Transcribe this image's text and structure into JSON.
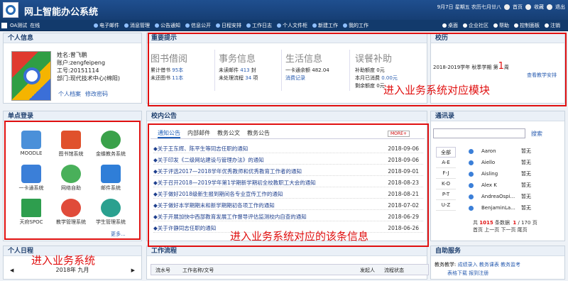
{
  "header": {
    "title": "网上智能办公系统",
    "top_right": [
      "9月7日 星期五 农历七月廿八",
      "首页",
      "收藏",
      "退出"
    ]
  },
  "user_bar": {
    "name": "OA测试",
    "status": "在线"
  },
  "nav": {
    "items": [
      "电子邮件",
      "消息管理",
      "公告通知",
      "信息公开",
      "日程安排",
      "工作日志",
      "个人文件柜",
      "新建工作",
      "我的工作"
    ],
    "right_items": [
      "桌面",
      "企业社区",
      "帮助",
      "控制面板",
      "注销"
    ]
  },
  "personal_info": {
    "title": "个人信息",
    "name": "姓名:曾飞鹏",
    "account": "账户:zengfeipeng",
    "job_no": "工号:20151114",
    "dept": "部门:现代技术中心(绵阳)",
    "link_profile": "个人档案",
    "link_password": "修改密码"
  },
  "notices": {
    "title": "重要提示",
    "library": {
      "title": "图书借阅",
      "r1_label": "累计借书",
      "r1_value": "95本",
      "r2_label": "未还图书",
      "r2_value": "11本"
    },
    "affairs": {
      "title": "事务信息",
      "r1_label": "未读邮件",
      "r1_value": "413",
      "r1_unit": "封",
      "r2_label": "未处理流程",
      "r2_value": "34",
      "r2_unit": "项"
    },
    "life": {
      "title": "生活信息",
      "r1_label": "一卡通余额",
      "r1_value": "482.04",
      "link": "消费记录"
    },
    "subsidy": {
      "title": "误餐补助",
      "r1_label": "补助额度",
      "r1_value": "0元",
      "r2_label": "本月已消费",
      "r2_value": "0.00元",
      "r3_label": "剩余额度",
      "r3_value": "0元"
    }
  },
  "calendar": {
    "title": "校历",
    "term": "2018-2019学年 秋季学期 第",
    "week": "1",
    "week_unit": "周",
    "link": "查看教学安排"
  },
  "sso": {
    "title": "单点登录",
    "apps": [
      "MOODLE",
      "图书馆系统",
      "金蝶教务系统",
      "一卡通系统",
      "网络自助",
      "邮件系统",
      "天府SPOC",
      "教学管理系统",
      "学生管理系统"
    ],
    "more": "更多..."
  },
  "news": {
    "title": "校内公告",
    "tabs": [
      "通知公告",
      "内部邮件",
      "教务公文",
      "教务公告"
    ],
    "more_btn": "MORE+",
    "items": [
      {
        "title": "◆关于王东辉、陈平生等同志任职的通知",
        "date": "2018-09-06"
      },
      {
        "title": "◆关于印发《二级网站建设与管理办法》的通知",
        "date": "2018-09-06"
      },
      {
        "title": "◆关于评选2017—2018学年优秀教师和优秀教育工作者的通知",
        "date": "2018-09-01"
      },
      {
        "title": "◆关于召开2018—2019学年第1学期新学期初全校教职工大会的通知",
        "date": "2018-08-23"
      },
      {
        "title": "◆关于做好2018级新生报到期间各专业宣传工作的通知",
        "date": "2018-08-21"
      },
      {
        "title": "◆关于做好本学期期末和新学期期初各项工作的通知",
        "date": "2018-07-02"
      },
      {
        "title": "◆关于开展加快中西部教育发展工作督导评估监测校内自查的通知",
        "date": "2018-06-29"
      },
      {
        "title": "◆关于许静同志任职的通知",
        "date": "2018-06-26"
      }
    ]
  },
  "workflow": {
    "title": "工作流程",
    "cols": [
      "流水号",
      "工作名称/文号",
      "发起人",
      "流程状态"
    ]
  },
  "schedule": {
    "title": "个人日程",
    "month": "2018年 九月"
  },
  "address_book": {
    "title": "通讯录",
    "search_btn": "搜索",
    "letters": [
      "全部",
      "A-E",
      "F-J",
      "K-O",
      "P-T",
      "U-Z"
    ],
    "contacts": [
      {
        "name": "Aaron",
        "status": "暂无"
      },
      {
        "name": "Aiello",
        "status": "暂无"
      },
      {
        "name": "Aisling",
        "status": "暂无"
      },
      {
        "name": "Alex K",
        "status": "暂无"
      },
      {
        "name": "AndreaOspi...",
        "status": "暂无"
      },
      {
        "name": "BenjaminLa...",
        "status": "暂无"
      }
    ],
    "pager_total_prefix": "共",
    "pager_total": "1015",
    "pager_total_mid": "条数据",
    "pager_page": "1",
    "pager_pages": "/ 170",
    "pager_page_unit": "页",
    "pager_links": "首页 上一页 下一页 尾页"
  },
  "self_service": {
    "title": "自助服务",
    "row1_label": "教务教学:",
    "row1_links": [
      "成绩录入",
      "教务课表",
      "教务监考"
    ],
    "row2_links": [
      "表格下载",
      "报到注册"
    ]
  },
  "annotations": {
    "a1": "进入业务系统对应模块",
    "a2": "进入业务系统",
    "a3": "进入业务系统对应的该条信息"
  },
  "colors": {
    "brand": "#1f4f8f",
    "accent": "#e01010",
    "link": "#2a5db0"
  }
}
